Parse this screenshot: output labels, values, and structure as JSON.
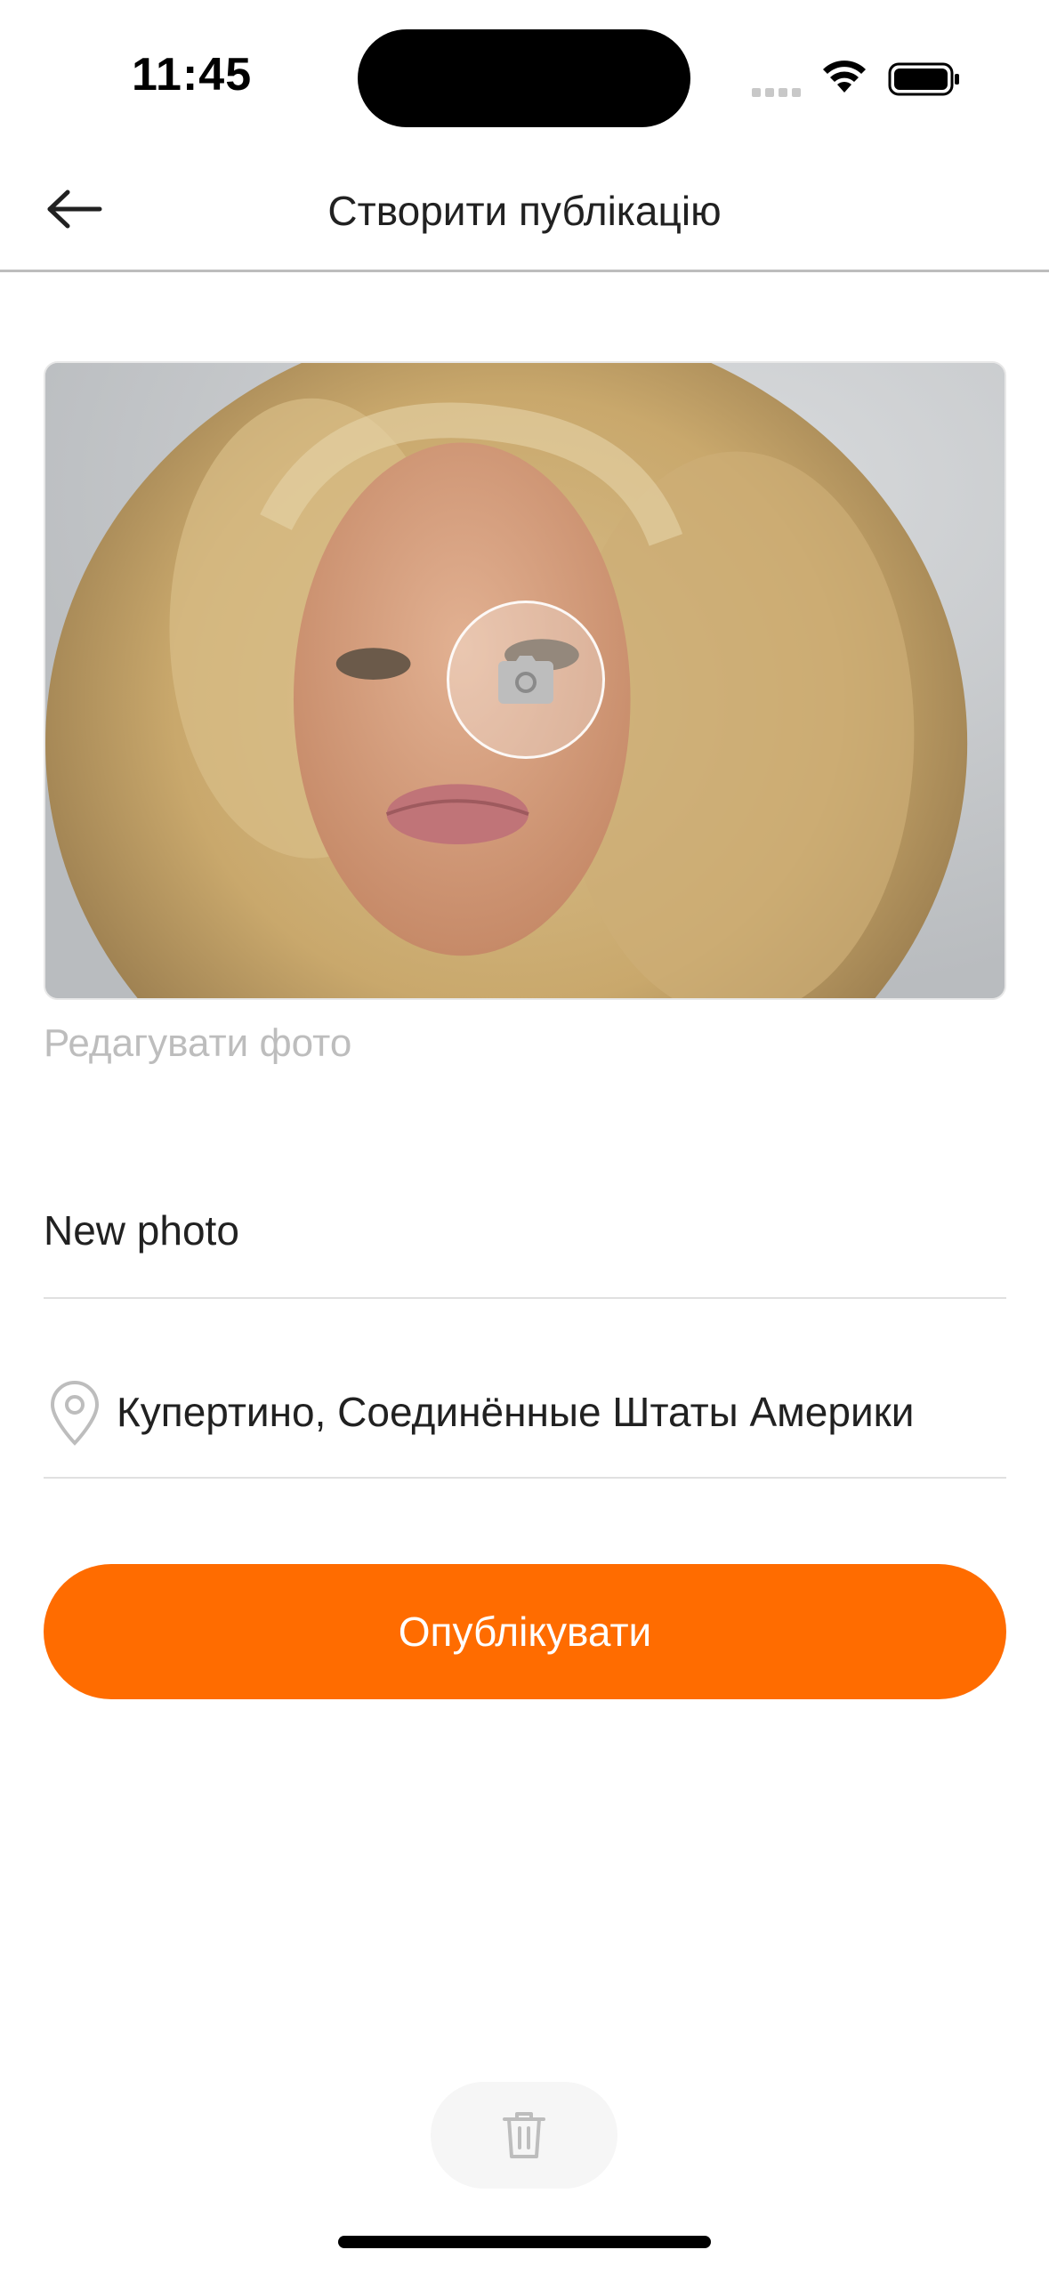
{
  "status_bar": {
    "time": "11:45",
    "icons": [
      "signal-icon",
      "wifi-icon",
      "battery-icon"
    ]
  },
  "header": {
    "back_icon": "arrow-left-icon",
    "title": "Створити публікацію"
  },
  "photo": {
    "camera_icon": "camera-icon",
    "edit_label": "Редагувати фото"
  },
  "form": {
    "title_value": "New photo",
    "location_icon": "map-pin-icon",
    "location_value": "Купертино, Соединённые Штаты Америки"
  },
  "actions": {
    "publish_label": "Опублікувати",
    "delete_icon": "trash-icon"
  },
  "colors": {
    "accent": "#FF6C00",
    "placeholder": "#BDBDBD",
    "divider": "#E0E0E0",
    "text": "#212121"
  }
}
